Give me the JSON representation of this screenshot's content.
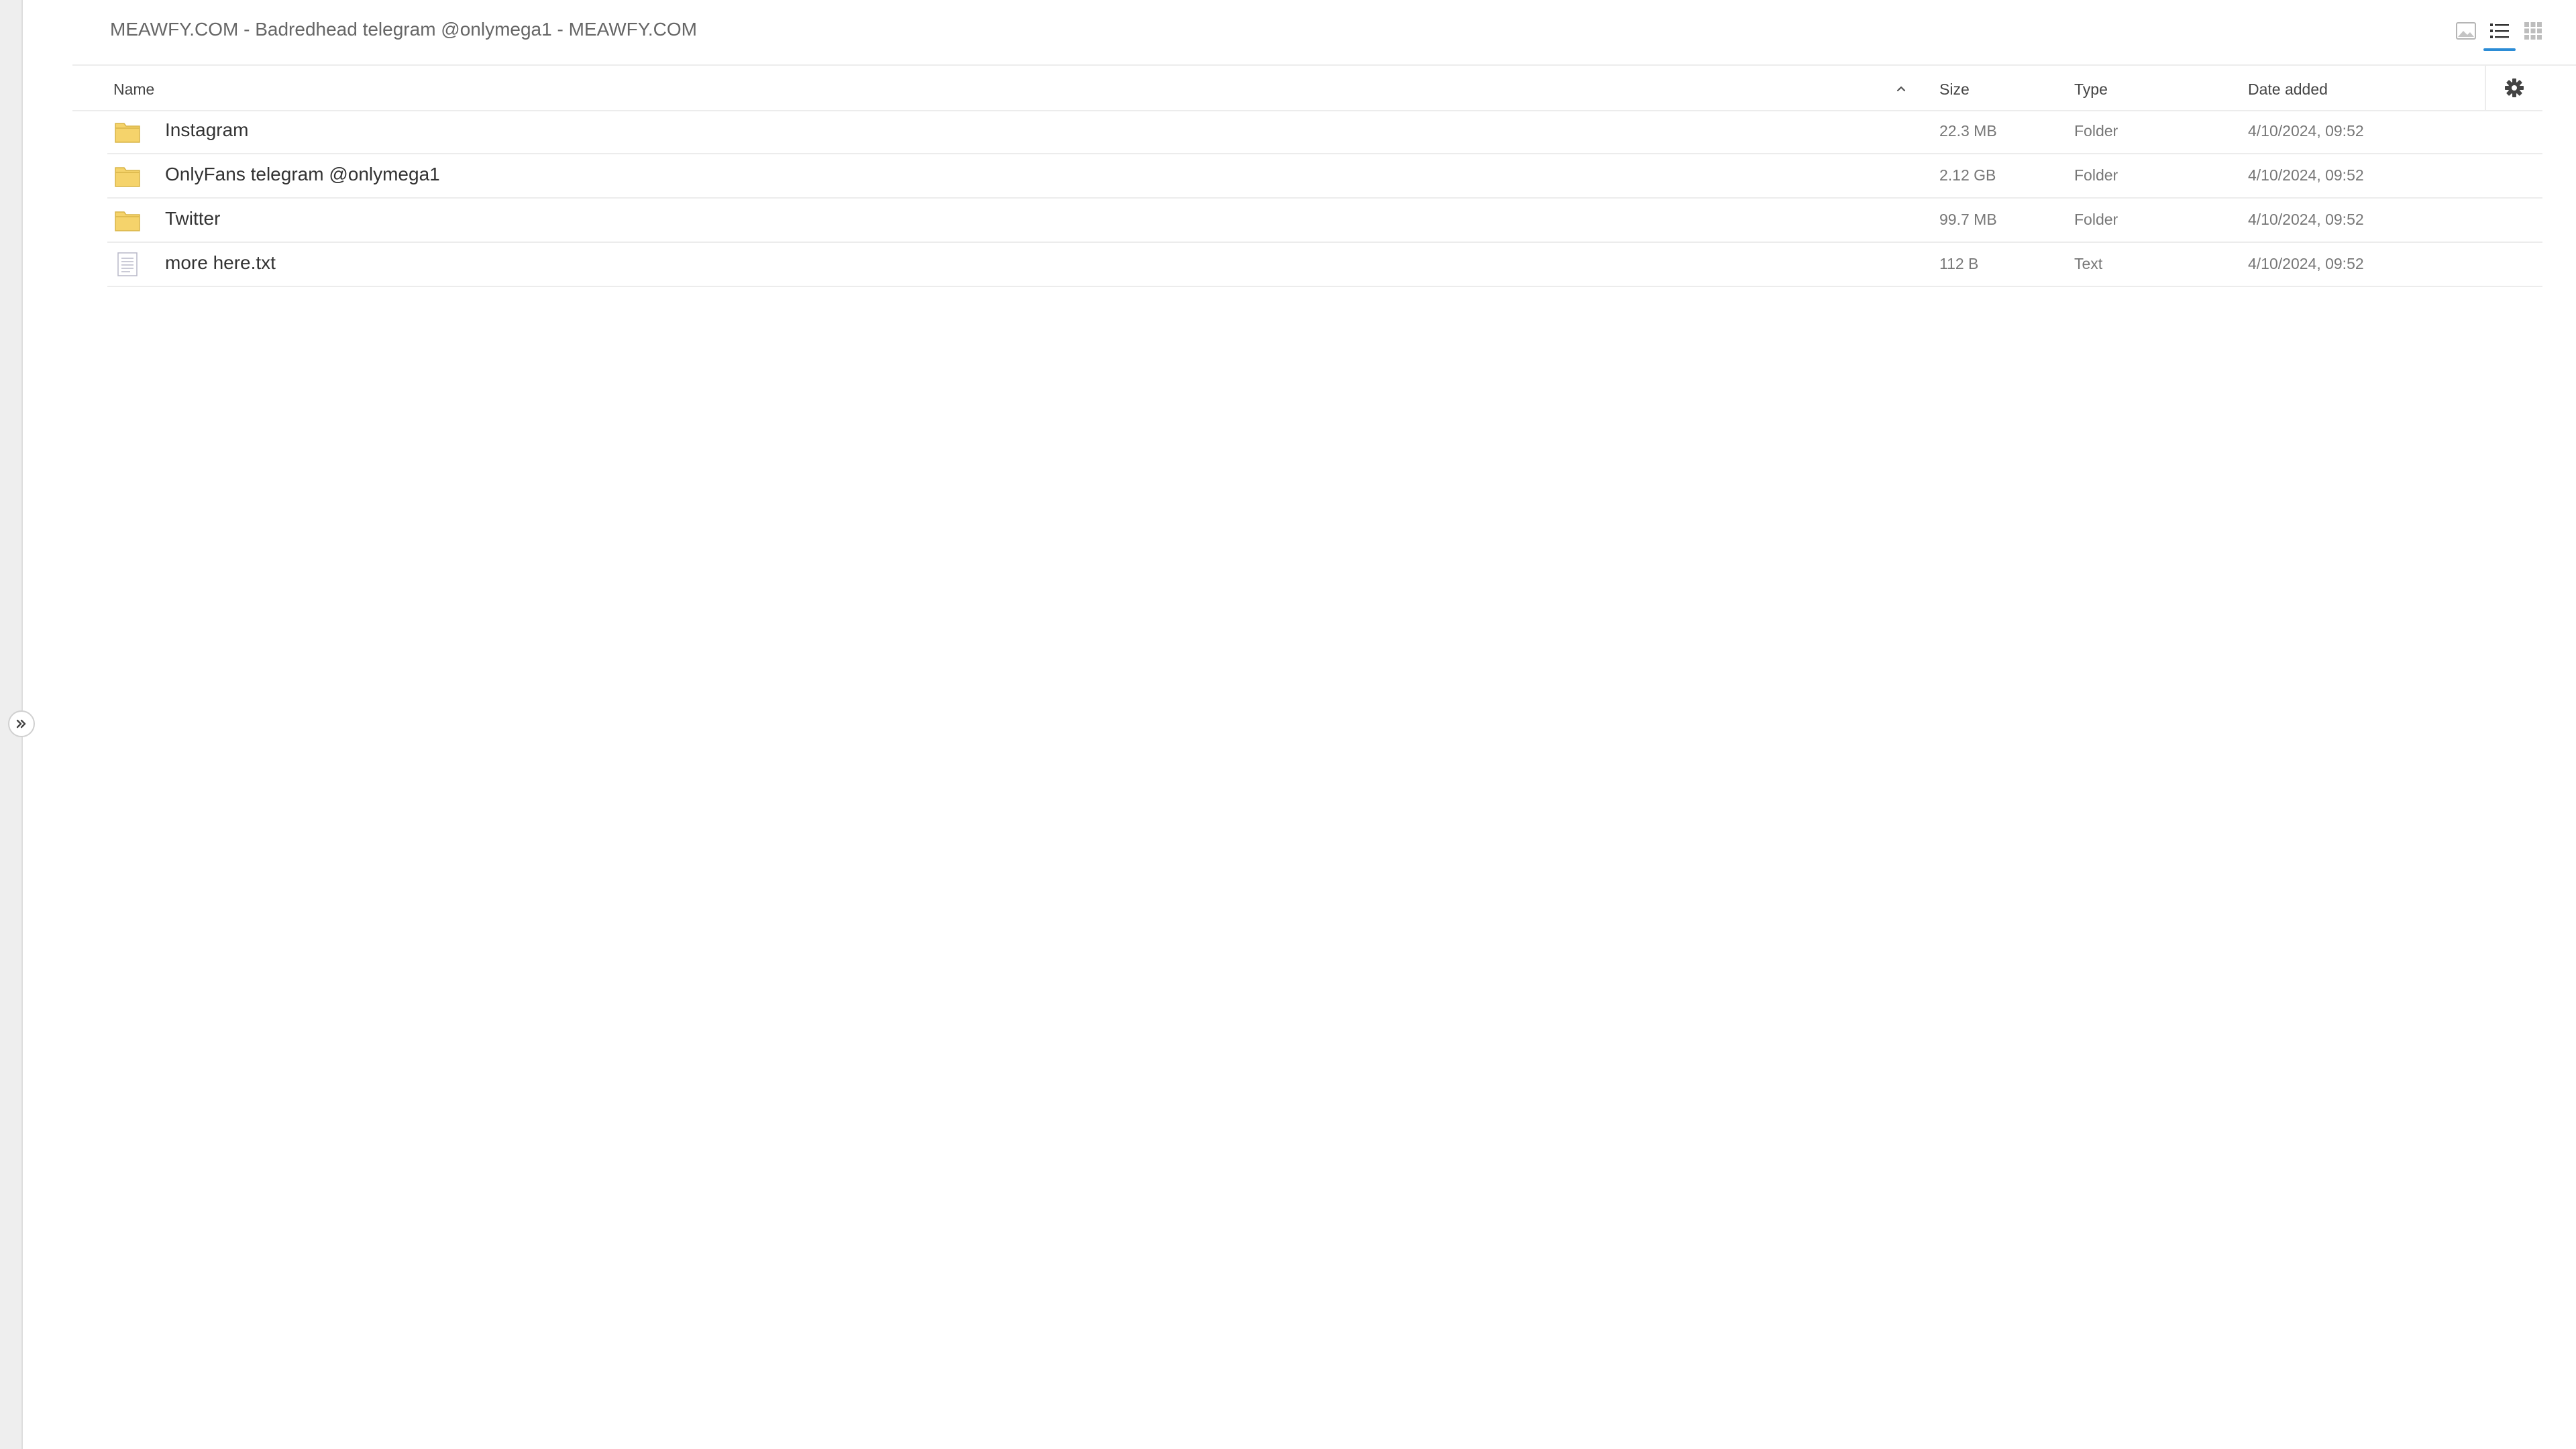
{
  "header": {
    "breadcrumb": "MEAWFY.COM - Badredhead telegram @onlymega1 - MEAWFY.COM",
    "views": [
      {
        "name": "thumbnail-view",
        "icon": "image-icon",
        "active": false
      },
      {
        "name": "list-view",
        "icon": "list-icon",
        "active": true
      },
      {
        "name": "grid-view",
        "icon": "grid-icon",
        "active": false
      }
    ],
    "accent_color": "#2b8cd6"
  },
  "table": {
    "columns": {
      "name": "Name",
      "size": "Size",
      "type": "Type",
      "date": "Date added"
    },
    "sort": {
      "column": "name",
      "direction": "ascending",
      "icon": "chevron-up-icon"
    },
    "settings_icon": "gear-icon",
    "rows": [
      {
        "icon": "folder-icon",
        "name": "Instagram",
        "size": "22.3 MB",
        "type": "Folder",
        "date": "4/10/2024, 09:52"
      },
      {
        "icon": "folder-icon",
        "name": "OnlyFans telegram @onlymega1",
        "size": "2.12 GB",
        "type": "Folder",
        "date": "4/10/2024, 09:52"
      },
      {
        "icon": "folder-icon",
        "name": "Twitter",
        "size": "99.7 MB",
        "type": "Folder",
        "date": "4/10/2024, 09:52"
      },
      {
        "icon": "text-file-icon",
        "name": "more here.txt",
        "size": "112 B",
        "type": "Text",
        "date": "4/10/2024, 09:52"
      }
    ]
  },
  "sidebar": {
    "expand_icon": "double-chevron-right-icon"
  },
  "colors": {
    "folder": "#f5d36b",
    "folder_stroke": "#d9b548"
  }
}
